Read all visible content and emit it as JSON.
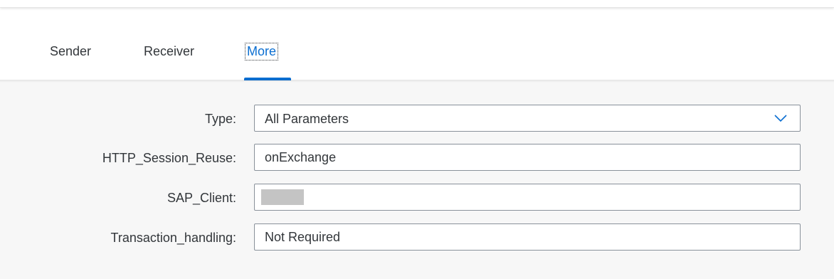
{
  "tabs": [
    {
      "label": "Sender"
    },
    {
      "label": "Receiver"
    },
    {
      "label": "More",
      "selected": true
    }
  ],
  "form": {
    "type": {
      "label": "Type:",
      "value": "All Parameters",
      "icon": "chevron-down-icon"
    },
    "http_session_reuse": {
      "label": "HTTP_Session_Reuse:",
      "value": "onExchange"
    },
    "sap_client": {
      "label": "SAP_Client:",
      "value": ""
    },
    "transaction_handling": {
      "label": "Transaction_handling:",
      "value": "Not Required"
    }
  },
  "colors": {
    "accent": "#0a6ed1",
    "text": "#32363a",
    "field_border": "#89919a",
    "background": "#f7f7f7"
  }
}
